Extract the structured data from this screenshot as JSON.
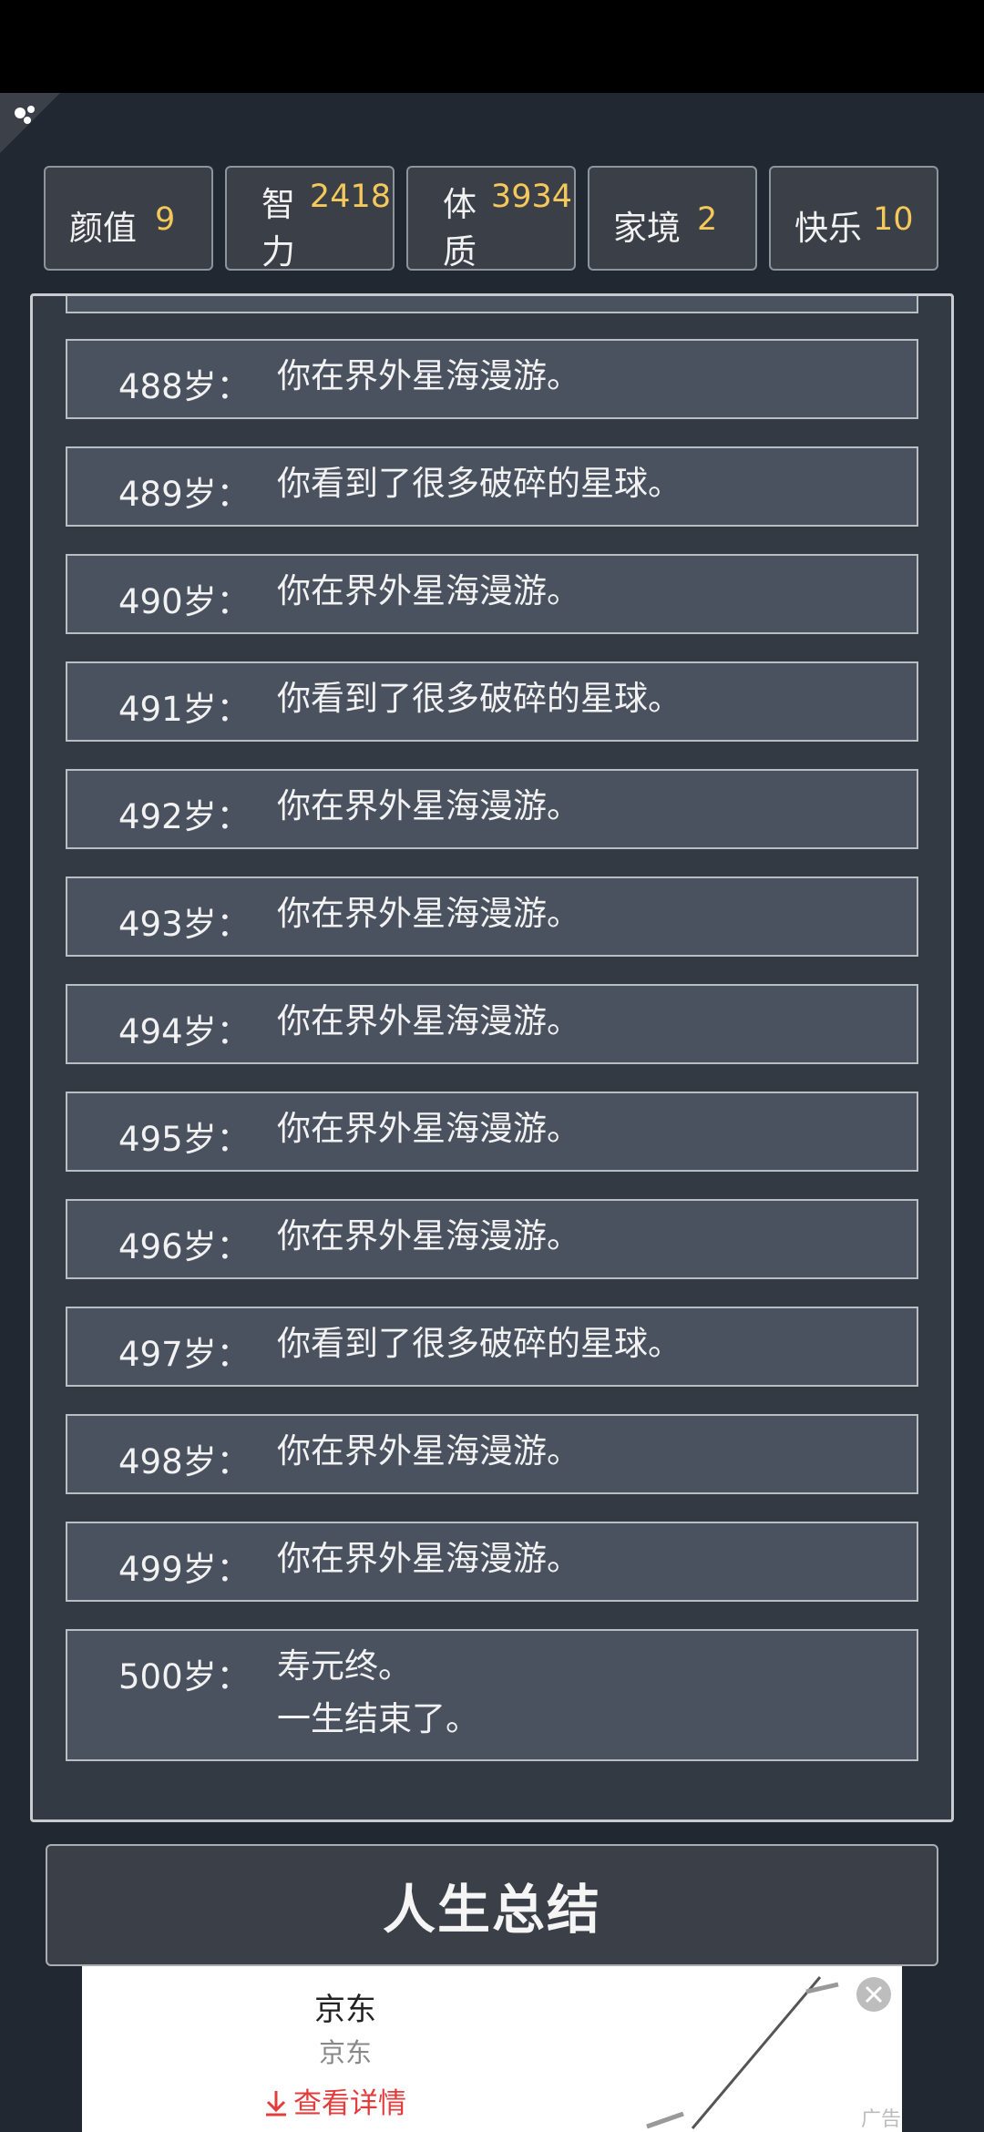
{
  "stats": [
    {
      "label": "颜值",
      "value": "9"
    },
    {
      "label_line1": "智",
      "label_line2": "力",
      "value": "2418"
    },
    {
      "label_line1": "体",
      "label_line2": "质",
      "value": "3934"
    },
    {
      "label": "家境",
      "value": "2"
    },
    {
      "label": "快乐",
      "value": "10"
    }
  ],
  "log": [
    {
      "age": "488岁：",
      "text": "你在界外星海漫游。"
    },
    {
      "age": "489岁：",
      "text": "你看到了很多破碎的星球。"
    },
    {
      "age": "490岁：",
      "text": "你在界外星海漫游。"
    },
    {
      "age": "491岁：",
      "text": "你看到了很多破碎的星球。"
    },
    {
      "age": "492岁：",
      "text": "你在界外星海漫游。"
    },
    {
      "age": "493岁：",
      "text": "你在界外星海漫游。"
    },
    {
      "age": "494岁：",
      "text": "你在界外星海漫游。"
    },
    {
      "age": "495岁：",
      "text": "你在界外星海漫游。"
    },
    {
      "age": "496岁：",
      "text": "你在界外星海漫游。"
    },
    {
      "age": "497岁：",
      "text": "你看到了很多破碎的星球。"
    },
    {
      "age": "498岁：",
      "text": "你在界外星海漫游。"
    },
    {
      "age": "499岁：",
      "text": "你在界外星海漫游。"
    },
    {
      "age": "500岁：",
      "text_line1": "寿元终。",
      "text_line2": "一生结束了。"
    }
  ],
  "summary_button": "人生总结",
  "ad": {
    "title": "京东",
    "subtitle": "京东",
    "cta": "查看详情",
    "tag": "广告"
  },
  "colors": {
    "background": "#222831",
    "stat_value": "#f4c85a",
    "ad_cta": "#e23c3c"
  }
}
